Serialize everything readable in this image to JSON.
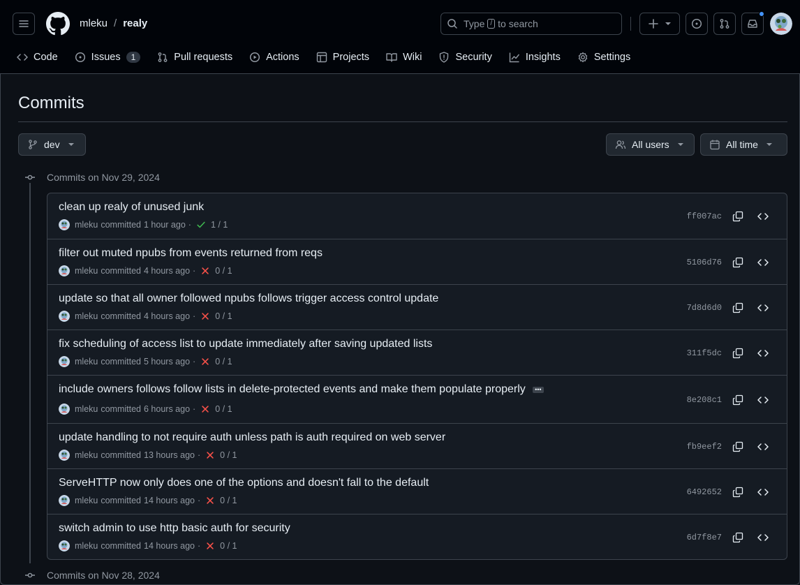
{
  "header": {
    "owner": "mleku",
    "separator": "/",
    "repo": "realy",
    "search_prefix": "Type",
    "search_key": "/",
    "search_suffix": "to search",
    "plus_label": "+"
  },
  "nav": {
    "items": [
      {
        "label": "Code",
        "icon": "code-icon"
      },
      {
        "label": "Issues",
        "icon": "issue-icon",
        "count": "1"
      },
      {
        "label": "Pull requests",
        "icon": "pull-request-icon"
      },
      {
        "label": "Actions",
        "icon": "play-icon"
      },
      {
        "label": "Projects",
        "icon": "table-icon"
      },
      {
        "label": "Wiki",
        "icon": "book-icon"
      },
      {
        "label": "Security",
        "icon": "shield-icon"
      },
      {
        "label": "Insights",
        "icon": "graph-icon"
      },
      {
        "label": "Settings",
        "icon": "gear-icon"
      }
    ]
  },
  "page": {
    "title": "Commits",
    "branch": "dev",
    "users_filter": "All users",
    "time_filter": "All time"
  },
  "groups": [
    {
      "label": "Commits on Nov 29, 2024"
    },
    {
      "label": "Commits on Nov 28, 2024"
    }
  ],
  "commits": [
    {
      "message": "clean up realy of unused junk",
      "author": "mleku",
      "verb": "committed",
      "time": "1 hour ago",
      "sep": "·",
      "status": "success",
      "checks": "1 / 1",
      "sha": "ff007ac"
    },
    {
      "message": "filter out muted npubs from events returned from reqs",
      "author": "mleku",
      "verb": "committed",
      "time": "4 hours ago",
      "sep": "·",
      "status": "failure",
      "checks": "0 / 1",
      "sha": "5106d76"
    },
    {
      "message": "update so that all owner followed npubs follows trigger access control update",
      "author": "mleku",
      "verb": "committed",
      "time": "4 hours ago",
      "sep": "·",
      "status": "failure",
      "checks": "0 / 1",
      "sha": "7d8d6d0"
    },
    {
      "message": "fix scheduling of access list to update immediately after saving updated lists",
      "author": "mleku",
      "verb": "committed",
      "time": "5 hours ago",
      "sep": "·",
      "status": "failure",
      "checks": "0 / 1",
      "sha": "311f5dc"
    },
    {
      "message": "include owners follows follow lists in delete-protected events and make them populate properly",
      "author": "mleku",
      "verb": "committed",
      "time": "6 hours ago",
      "sep": "·",
      "status": "failure",
      "checks": "0 / 1",
      "sha": "8e208c1",
      "has_more": true
    },
    {
      "message": "update handling to not require auth unless path is auth required on web server",
      "author": "mleku",
      "verb": "committed",
      "time": "13 hours ago",
      "sep": "·",
      "status": "failure",
      "checks": "0 / 1",
      "sha": "fb9eef2"
    },
    {
      "message": "ServeHTTP now only does one of the options and doesn't fall to the default",
      "author": "mleku",
      "verb": "committed",
      "time": "14 hours ago",
      "sep": "·",
      "status": "failure",
      "checks": "0 / 1",
      "sha": "6492652"
    },
    {
      "message": "switch admin to use http basic auth for security",
      "author": "mleku",
      "verb": "committed",
      "time": "14 hours ago",
      "sep": "·",
      "status": "failure",
      "checks": "0 / 1",
      "sha": "6d7f8e7"
    }
  ],
  "colors": {
    "success": "#3fb950",
    "failure": "#f85149",
    "notification": "#4493f8"
  }
}
